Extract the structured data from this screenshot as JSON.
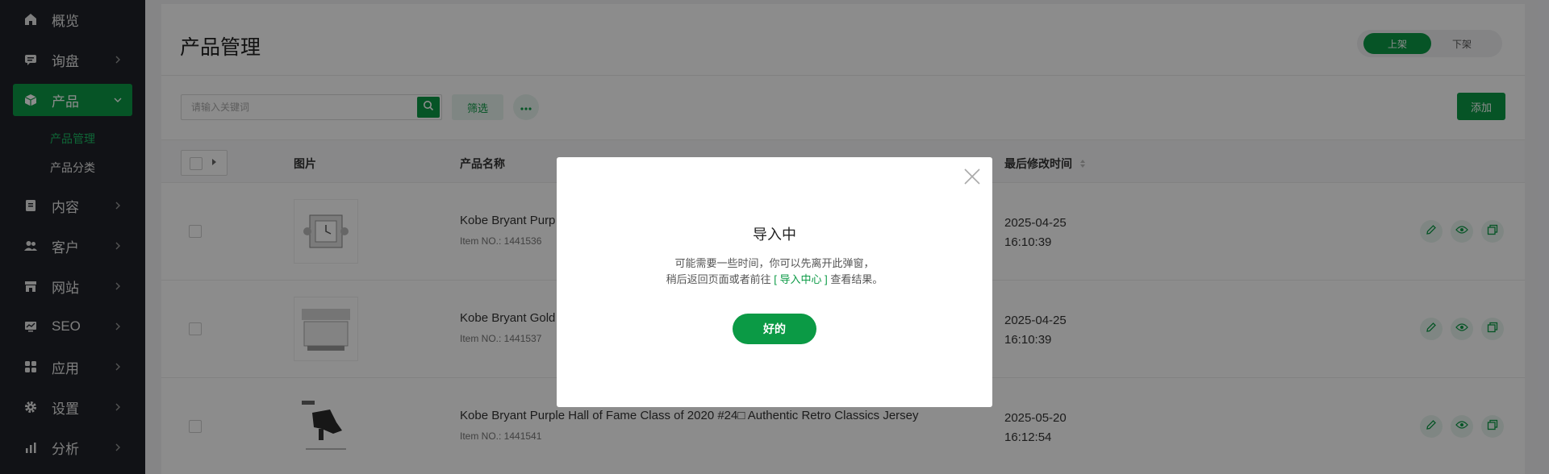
{
  "sidebar": {
    "items": [
      {
        "label": "概览",
        "icon": "home-icon"
      },
      {
        "label": "询盘",
        "icon": "message-icon"
      },
      {
        "label": "产品",
        "icon": "box-icon"
      },
      {
        "label": "内容",
        "icon": "document-icon"
      },
      {
        "label": "客户",
        "icon": "users-icon"
      },
      {
        "label": "网站",
        "icon": "store-icon"
      },
      {
        "label": "SEO",
        "icon": "monitor-chart-icon"
      },
      {
        "label": "应用",
        "icon": "apps-icon"
      },
      {
        "label": "设置",
        "icon": "gear-icon"
      },
      {
        "label": "分析",
        "icon": "bar-chart-icon"
      }
    ],
    "sub_items": [
      {
        "label": "产品管理"
      },
      {
        "label": "产品分类"
      }
    ]
  },
  "main": {
    "title": "产品管理",
    "segment": {
      "on": "上架",
      "off": "下架"
    },
    "search": {
      "placeholder": "请输入关键词"
    },
    "filter_label": "筛选",
    "add_label": "添加",
    "columns": {
      "image": "图片",
      "name": "产品名称",
      "modified": "最后修改时间"
    },
    "rows": [
      {
        "name": "Kobe Bryant Purp",
        "item_no": "Item NO.: 1441536",
        "date": "2025-04-25",
        "time": "16:10:39"
      },
      {
        "name": "Kobe Bryant Gold",
        "item_no": "Item NO.: 1441537",
        "date": "2025-04-25",
        "time": "16:10:39"
      },
      {
        "name": "Kobe Bryant Purple Hall of Fame Class of 2020 #24□ Authentic Retro Classics Jersey",
        "item_no": "Item NO.: 1441541",
        "date": "2025-05-20",
        "time": "16:12:54"
      }
    ]
  },
  "modal": {
    "title": "导入中",
    "line1": "可能需要一些时间，你可以先离开此弹窗，",
    "line2_prefix": "稍后返回页面或者前往",
    "link": "[ 导入中心 ]",
    "line2_suffix": "查看结果。",
    "ok": "好的"
  },
  "colors": {
    "accent": "#0b9a45",
    "sidebar_bg": "#1f2229"
  }
}
